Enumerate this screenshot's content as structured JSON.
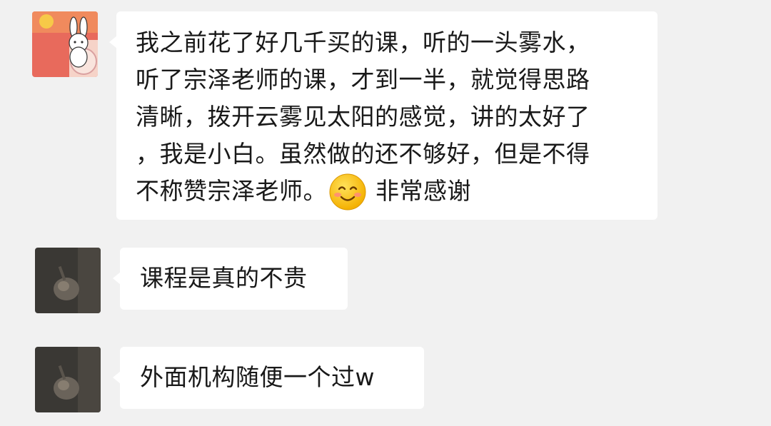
{
  "messages": [
    {
      "avatar": "bunny-avatar",
      "lines": [
        "我之前花了好几千买的课，听的一头雾水，",
        "听了宗泽老师的课，才到一半，就觉得思路",
        "清晰，拨开云雾见太阳的感觉，讲的太好了",
        "，我是小白。虽然做的还不够好，但是不得"
      ],
      "last_line_before_emoji": "不称赞宗泽老师。",
      "emoji": "smiling-face-icon",
      "last_line_after_emoji": "非常感谢"
    },
    {
      "avatar": "dark-photo-avatar",
      "text": "课程是真的不贵"
    },
    {
      "avatar": "dark-photo-avatar",
      "text": "外面机构随便一个过w"
    }
  ],
  "colors": {
    "background": "#f1f1f1",
    "bubble": "#ffffff",
    "text": "#191919"
  }
}
